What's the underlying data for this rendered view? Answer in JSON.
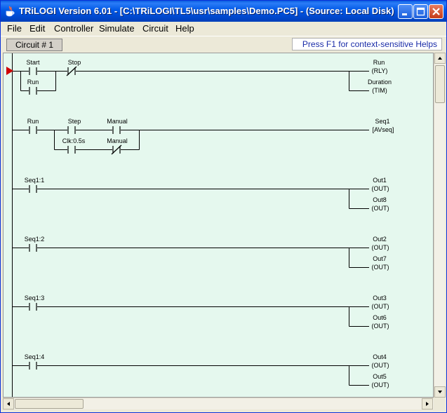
{
  "window": {
    "title": "TRiLOGI Version 6.01 - [C:\\TRiLOGI\\TL5\\usr\\samples\\Demo.PC5] - (Source: Local Disk)"
  },
  "menu": [
    "File",
    "Edit",
    "Controller",
    "Simulate",
    "Circuit",
    "Help"
  ],
  "tabs": {
    "circuit_tab": "Circuit # 1",
    "help_hint": "Press F1 for context-sensitive Helps"
  },
  "circuits": [
    {
      "contacts": [
        "Start",
        "Stop",
        "Run"
      ],
      "coils": [
        {
          "name": "Run",
          "type": "(RLY)"
        },
        {
          "name": "Duration",
          "type": "(TIM)"
        }
      ]
    },
    {
      "contacts": [
        "Run",
        "Step",
        "Manual",
        "Clk:0.5s",
        "Manual"
      ],
      "coils": [
        {
          "name": "Seq1",
          "type": "[AVseq]"
        }
      ]
    },
    {
      "contacts": [
        "Seq1:1"
      ],
      "coils": [
        {
          "name": "Out1",
          "type": "(OUT)"
        },
        {
          "name": "Out8",
          "type": "(OUT)"
        }
      ]
    },
    {
      "contacts": [
        "Seq1:2"
      ],
      "coils": [
        {
          "name": "Out2",
          "type": "(OUT)"
        },
        {
          "name": "Out7",
          "type": "(OUT)"
        }
      ]
    },
    {
      "contacts": [
        "Seq1:3"
      ],
      "coils": [
        {
          "name": "Out3",
          "type": "(OUT)"
        },
        {
          "name": "Out6",
          "type": "(OUT)"
        }
      ]
    },
    {
      "contacts": [
        "Seq1:4"
      ],
      "coils": [
        {
          "name": "Out4",
          "type": "(OUT)"
        },
        {
          "name": "Out5",
          "type": "(OUT)"
        }
      ]
    }
  ],
  "colors": {
    "titlebar": "#0058e6",
    "ladder_background": "#e5f8ee",
    "current_circuit_marker": "#d00000",
    "help_text": "#1a2ca8"
  }
}
